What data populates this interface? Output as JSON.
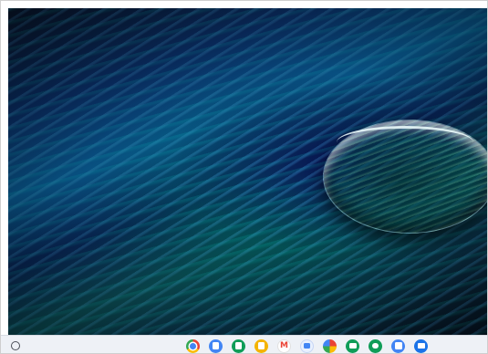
{
  "desktop": {
    "wallpaper": "peacock-feather-with-water-droplet"
  },
  "shelf": {
    "launcher_icon": "launcher-circle-icon",
    "apps": [
      {
        "name": "chrome-icon",
        "color": "#4285f4",
        "glyph": ""
      },
      {
        "name": "docs-icon",
        "color": "#4285f4",
        "glyph": ""
      },
      {
        "name": "sheets-icon",
        "color": "#0f9d58",
        "glyph": ""
      },
      {
        "name": "slides-icon",
        "color": "#f4b400",
        "glyph": ""
      },
      {
        "name": "gmail-icon",
        "color": "#ea4335",
        "glyph": "M"
      },
      {
        "name": "meet-icon",
        "color": "#4285f4",
        "glyph": ""
      },
      {
        "name": "photos-icon",
        "color": "#ea4335",
        "glyph": ""
      },
      {
        "name": "classroom-icon",
        "color": "#0f9d58",
        "glyph": ""
      },
      {
        "name": "chat-icon",
        "color": "#0f9d58",
        "glyph": ""
      },
      {
        "name": "calendar-icon",
        "color": "#4285f4",
        "glyph": ""
      },
      {
        "name": "files-icon",
        "color": "#1a73e8",
        "glyph": ""
      }
    ]
  }
}
